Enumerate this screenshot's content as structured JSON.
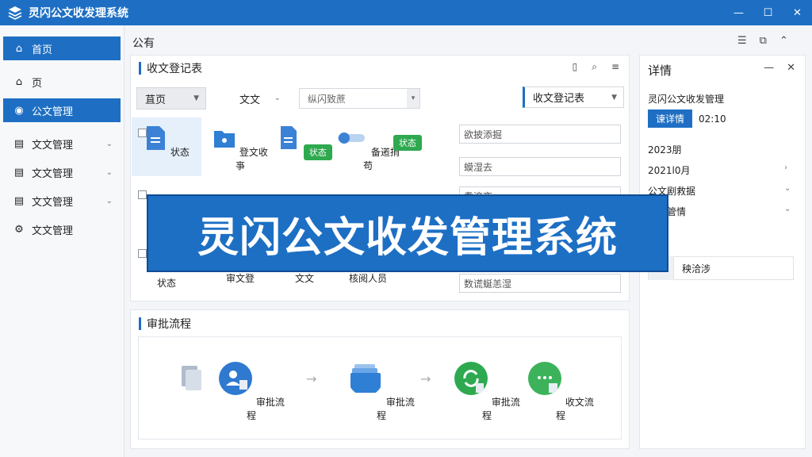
{
  "window": {
    "title": "灵闪公文收发理系统",
    "min": "—",
    "max": "☐",
    "close": "✕"
  },
  "sidebar": {
    "items": [
      {
        "label": "首页",
        "icon": "home-icon",
        "glyph": "⌂",
        "active": true,
        "chevron": false
      },
      {
        "label": "页",
        "icon": "home-icon",
        "glyph": "⌂",
        "active": false,
        "chevron": false
      },
      {
        "label": "公文管理",
        "icon": "shield-icon",
        "glyph": "◉",
        "active": true,
        "chevron": false
      },
      {
        "label": "文文管理",
        "icon": "document-icon",
        "glyph": "▤",
        "active": false,
        "chevron": true
      },
      {
        "label": "文文管理",
        "icon": "document-icon",
        "glyph": "▤",
        "active": false,
        "chevron": true
      },
      {
        "label": "文文管理",
        "icon": "document-icon",
        "glyph": "▤",
        "active": false,
        "chevron": true
      },
      {
        "label": "文文管理",
        "icon": "gear-icon",
        "glyph": "⚙",
        "active": false,
        "chevron": false
      }
    ]
  },
  "breadcrumb": "公有",
  "card1": {
    "title": "收文登记表",
    "filters": {
      "home": "苴页",
      "text": "文文",
      "search_value": "纵闪致蔗",
      "register": "收文登记表"
    },
    "row1": [
      {
        "label": "状态",
        "icon": "document-icon",
        "color": "#3b82d6"
      },
      {
        "label": "登文收亊",
        "icon": "folder-icon",
        "color": "#2f7fd4"
      },
      {
        "label": "状态",
        "icon": "document-icon",
        "color": "#3b82d6",
        "badge": true
      },
      {
        "label": "备逽捎苟",
        "icon": "toggle-icon",
        "color": "#6ea3e0",
        "side_badge": "状态"
      }
    ],
    "row3": [
      {
        "label": "状态"
      },
      {
        "label": "审文登"
      },
      {
        "label": "文文"
      },
      {
        "label": "核阅人员"
      }
    ],
    "fields": [
      "欲披添掘",
      "蟆湿去",
      "翥滚夜",
      "数谎蜒恙湿"
    ]
  },
  "card2": {
    "title": "审批流程",
    "nodes": [
      {
        "label": "",
        "icon": "files-icon",
        "color": "#cfd8e3"
      },
      {
        "label": "审批流程",
        "icon": "user-approve-icon",
        "color": "#2f79d0"
      },
      {
        "label": "审批流程",
        "icon": "folder-stack-icon",
        "color": "#2f7fd4"
      },
      {
        "label": "审批流程",
        "icon": "refresh-icon",
        "color": "#2ea94f"
      },
      {
        "label": "收文流程",
        "icon": "chat-icon",
        "color": "#3cb35a"
      }
    ],
    "arrow": "→"
  },
  "detail": {
    "title": "详情",
    "name": "灵闪公文收发管理",
    "btn": "谏详情",
    "code": "02:10",
    "rows": [
      "2023朋",
      "2021l0月",
      "公文剧救据",
      "发文管情"
    ],
    "section": "情",
    "item": "秧洽涉"
  },
  "banner": "灵闪公文收发管理系统"
}
